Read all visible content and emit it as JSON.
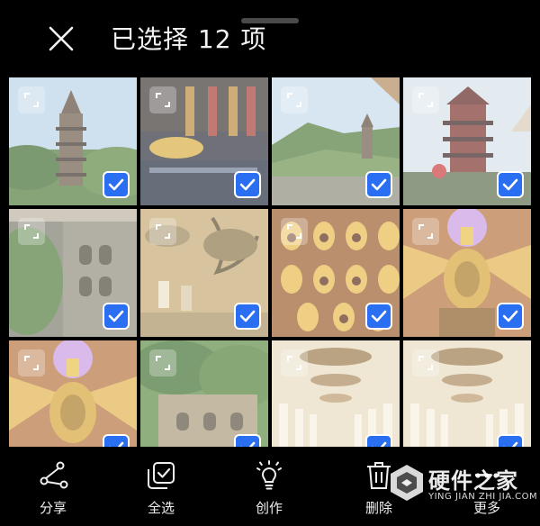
{
  "header": {
    "title": "已选择 12 项",
    "close_icon": "close-icon"
  },
  "photos": [
    {
      "subject": "pagoda-on-hill",
      "selected": true
    },
    {
      "subject": "golden-buddha-hall",
      "selected": true
    },
    {
      "subject": "pagoda-distant",
      "selected": true
    },
    {
      "subject": "tiered-pagoda-red",
      "selected": true
    },
    {
      "subject": "cliff-carvings",
      "selected": true
    },
    {
      "subject": "ancient-painting",
      "selected": true
    },
    {
      "subject": "golden-dome-ceiling",
      "selected": true
    },
    {
      "subject": "golden-stupa",
      "selected": true
    },
    {
      "subject": "golden-stupa-2",
      "selected": true
    },
    {
      "subject": "green-cliff",
      "selected": true
    },
    {
      "subject": "corridor-arches",
      "selected": true
    },
    {
      "subject": "corridor-arches-2",
      "selected": true
    }
  ],
  "actions": [
    {
      "label": "分享",
      "icon": "share-icon"
    },
    {
      "label": "全选",
      "icon": "select-all-icon"
    },
    {
      "label": "创作",
      "icon": "create-icon"
    },
    {
      "label": "删除",
      "icon": "delete-icon"
    },
    {
      "label": "更多",
      "icon": "more-icon"
    }
  ],
  "watermark": {
    "text": "硬件之家",
    "sub": "YING JIAN ZHI JIA.COM"
  },
  "colors": {
    "accent": "#2a6ff2",
    "background": "#000000"
  }
}
